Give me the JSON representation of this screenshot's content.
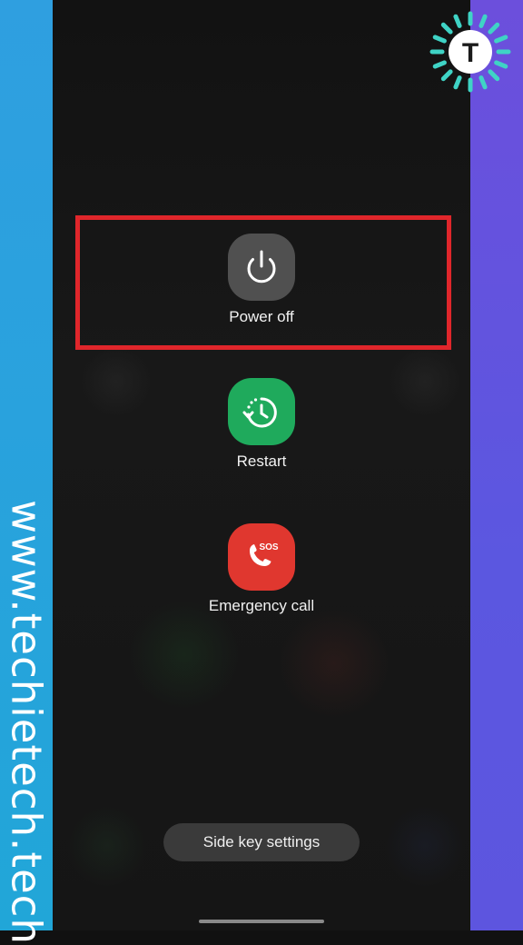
{
  "watermark": {
    "text": "www.techietech.tech",
    "logo_letter": "T"
  },
  "power_menu": {
    "items": [
      {
        "label": "Power off",
        "icon": "power-icon",
        "color": "#505050"
      },
      {
        "label": "Restart",
        "icon": "restart-icon",
        "color": "#1faa5c"
      },
      {
        "label": "Emergency call",
        "icon": "sos-call-icon",
        "color": "#e0372f",
        "badge": "SOS"
      }
    ],
    "highlight_color": "#e0262b",
    "side_key_button": "Side key settings"
  },
  "colors": {
    "left_band": "#27a3dc",
    "right_band": "#5d55df",
    "logo_ring": "#3fd3c5"
  }
}
